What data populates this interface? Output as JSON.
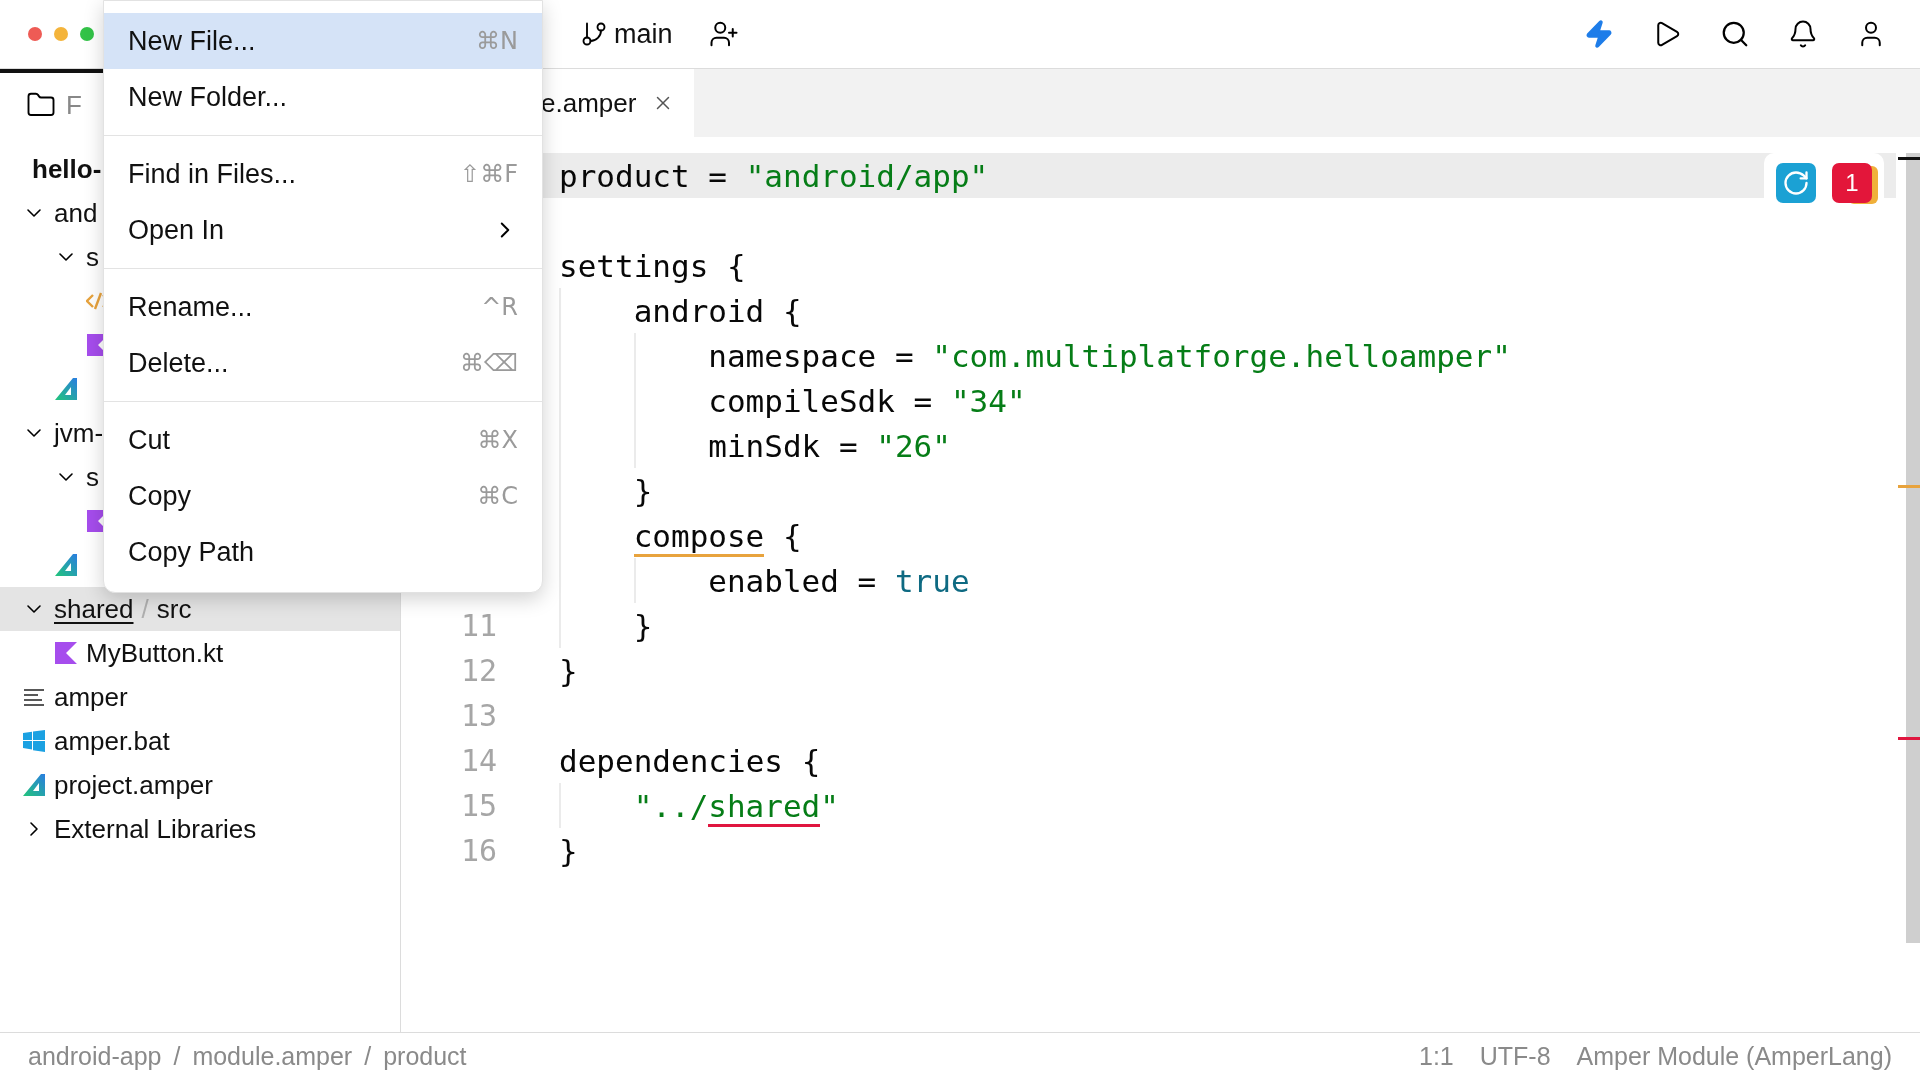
{
  "toolbar": {
    "branch": "main"
  },
  "sidebar": {
    "tab_label": "F",
    "tree": [
      {
        "label": "hello-",
        "kind": "root",
        "selected": false
      },
      {
        "label": "and",
        "kind": "folder",
        "expanded": true,
        "selected": false,
        "children": [
          {
            "label": "s",
            "kind": "folder",
            "expanded": true,
            "selected": false,
            "children": [
              {
                "kind": "xml",
                "selected": false
              },
              {
                "kind": "kotlin",
                "selected": false
              }
            ]
          },
          {
            "kind": "amper",
            "selected": false
          }
        ]
      },
      {
        "label": "jvm-",
        "kind": "folder",
        "expanded": true,
        "selected": false,
        "children": [
          {
            "label": "s",
            "kind": "folder",
            "expanded": true,
            "selected": false,
            "children": [
              {
                "kind": "kotlin",
                "selected": false
              }
            ]
          },
          {
            "kind": "amper",
            "selected": false
          }
        ]
      },
      {
        "label": "shared",
        "path_separator": "/",
        "path": "src",
        "kind": "folder",
        "expanded": true,
        "selected": true,
        "problem": true,
        "children": [
          {
            "label": "MyButton.kt",
            "kind": "kotlin",
            "selected": false
          }
        ]
      },
      {
        "label": "amper",
        "kind": "script",
        "selected": false
      },
      {
        "label": "amper.bat",
        "kind": "windows",
        "selected": false
      },
      {
        "label": "project.amper",
        "kind": "amper",
        "selected": false
      },
      {
        "label": "External Libraries",
        "kind": "folder",
        "expanded": false,
        "selected": false
      }
    ]
  },
  "context_menu": {
    "groups": [
      [
        {
          "label": "New File...",
          "shortcut": "⌘N",
          "selected": true
        },
        {
          "label": "New Folder...",
          "selected": false
        }
      ],
      [
        {
          "label": "Find in Files...",
          "shortcut": "⇧⌘F",
          "selected": false
        },
        {
          "label": "Open In",
          "submenu": true,
          "selected": false
        }
      ],
      [
        {
          "label": "Rename...",
          "shortcut": "^R",
          "selected": false
        },
        {
          "label": "Delete...",
          "shortcut": "⌘⌫",
          "selected": false
        }
      ],
      [
        {
          "label": "Cut",
          "shortcut": "⌘X",
          "selected": false
        },
        {
          "label": "Copy",
          "shortcut": "⌘C",
          "selected": false
        },
        {
          "label": "Copy Path",
          "selected": false
        }
      ]
    ]
  },
  "editor": {
    "tab": {
      "label": "e.amper"
    },
    "problem_count": "1",
    "lines": [
      {
        "current": true,
        "tokens": [
          {
            "text": "product = ",
            "kind": "plain"
          },
          {
            "text": "\"android/app\"",
            "kind": "string"
          }
        ]
      },
      {
        "current": false
      },
      {
        "current": false,
        "tokens": [
          {
            "text": "settings {",
            "kind": "plain"
          }
        ],
        "children": [
          {
            "current": false,
            "tokens": [
              {
                "text": "android {",
                "kind": "plain"
              }
            ],
            "children": [
              {
                "current": false,
                "tokens": [
                  {
                    "text": "namespace = ",
                    "kind": "plain"
                  },
                  {
                    "text": "\"com.multiplatforge.helloamper\"",
                    "kind": "string"
                  }
                ]
              },
              {
                "current": false,
                "tokens": [
                  {
                    "text": "compileSdk = ",
                    "kind": "plain"
                  },
                  {
                    "text": "\"34\"",
                    "kind": "string"
                  }
                ]
              },
              {
                "current": false,
                "tokens": [
                  {
                    "text": "minSdk = ",
                    "kind": "plain"
                  },
                  {
                    "text": "\"26\"",
                    "kind": "string"
                  }
                ]
              }
            ]
          },
          {
            "current": false,
            "tokens": [
              {
                "text": "}",
                "kind": "plain"
              }
            ]
          },
          {
            "current": false,
            "tokens": [
              {
                "text": "compose",
                "kind": "plain",
                "warning": true
              },
              {
                "text": " {",
                "kind": "plain"
              }
            ],
            "children": [
              {
                "current": false,
                "tokens": [
                  {
                    "text": "enabled = ",
                    "kind": "plain"
                  },
                  {
                    "text": "true",
                    "kind": "keyword"
                  }
                ]
              }
            ]
          },
          {
            "number": "11",
            "current": false,
            "tokens": [
              {
                "text": "}",
                "kind": "plain"
              }
            ]
          }
        ]
      },
      {
        "number": "12",
        "current": false,
        "tokens": [
          {
            "text": "}",
            "kind": "plain"
          }
        ]
      },
      {
        "number": "13",
        "current": false
      },
      {
        "number": "14",
        "current": false,
        "tokens": [
          {
            "text": "dependencies {",
            "kind": "plain"
          }
        ],
        "children": [
          {
            "number": "15",
            "current": false,
            "tokens": [
              {
                "text": "\"../",
                "kind": "string"
              },
              {
                "text": "shared",
                "kind": "string",
                "error": true
              },
              {
                "text": "\"",
                "kind": "string"
              }
            ]
          }
        ]
      },
      {
        "number": "16",
        "current": false,
        "tokens": [
          {
            "text": "}",
            "kind": "plain"
          }
        ]
      }
    ]
  },
  "status_bar": {
    "breadcrumbs": [
      "android-app",
      "module.amper",
      "product"
    ],
    "breadcrumb_separator": "/",
    "position": "1:1",
    "encoding": "UTF-8",
    "file_type": "Amper Module (AmperLang)"
  }
}
